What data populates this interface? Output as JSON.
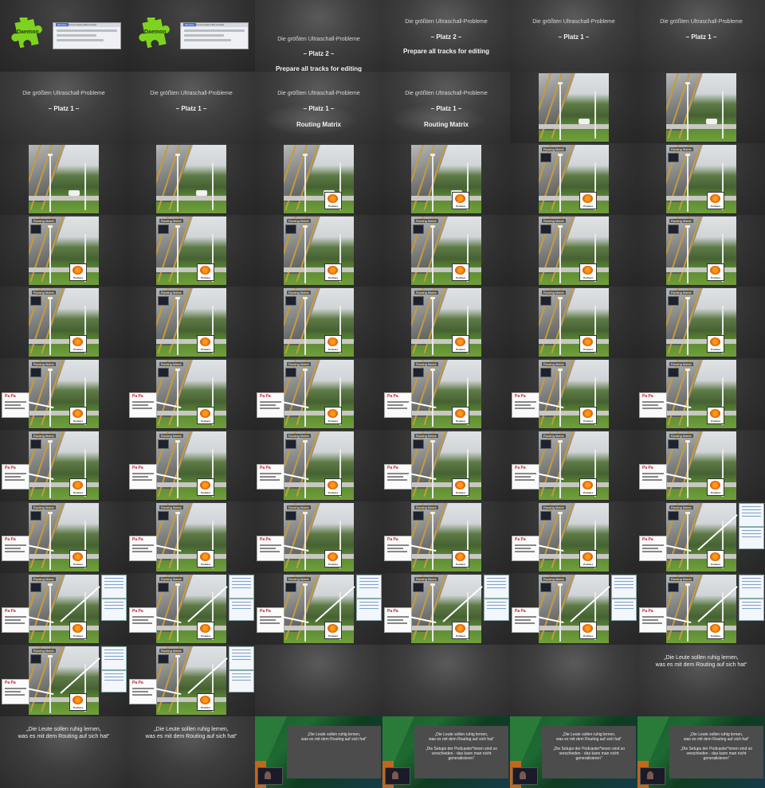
{
  "daemon": {
    "logo_label": "Daemon",
    "menu_items": [
      "Services",
      "Kommentare",
      "Hilfe",
      "Fenster"
    ]
  },
  "titles": {
    "subtitle": "Die größten Ultraschall-Probleme",
    "rank_2": "– Platz 2 –",
    "rank_1": "– Platz 1 –",
    "prepare": "Prepare all tracks for editing",
    "routing": "Routing Matrix"
  },
  "photo": {
    "routing_label": "Routing Matrix",
    "podcast_label": "Podcast",
    "doc_head": "Pa Pa"
  },
  "quotes": {
    "line_1": "„Die Leute sollen ruhig lernen,",
    "line_2": "was es mit dem Routing auf sich hat“",
    "line_3": "„Die Setups der Podcaster*innen sind so",
    "line_4": "verschieden - das kann man nicht",
    "line_5": "generalisieren“"
  },
  "colors": {
    "background": "#2a2a2a",
    "puzzle_green": "#7ed321",
    "podcast_orange": "#ff8a00"
  },
  "cells": [
    "daemon",
    "daemon",
    "title2p_low",
    "title2p",
    "title1",
    "title1",
    "title1",
    "title1",
    "title1routing",
    "title1routing",
    "photo",
    "photo",
    "photo",
    "photo",
    "photo_pod",
    "photo_pod",
    "photo_lbl_pod",
    "photo_lbl_pod",
    "photo_lbl_pod",
    "photo_lbl_pod",
    "photo_lbl_pod",
    "photo_lbl_pod",
    "photo_lbl_pod",
    "photo_lbl_pod",
    "photo_lbl_pod",
    "photo_lbl_pod",
    "photo_lbl_pod",
    "photo_lbl_pod",
    "photo_lbl_pod",
    "photo_lbl_pod",
    "photo_doc",
    "photo_doc",
    "photo_doc",
    "photo_doc",
    "photo_doc",
    "photo_doc",
    "photo_doc",
    "photo_doc",
    "photo_doc",
    "photo_doc",
    "photo_doc",
    "photo_doc",
    "photo_doc",
    "photo_doc",
    "photo_doc",
    "photo_doc",
    "photo_doc",
    "photo_full",
    "photo_full",
    "photo_full",
    "photo_full",
    "photo_full",
    "photo_full",
    "photo_full",
    "photo_full",
    "photo_full",
    "blank",
    "blank",
    "blank",
    "quote_small",
    "quote",
    "quote",
    "stage_1",
    "stage_2",
    "stage_2",
    "stage_2"
  ]
}
